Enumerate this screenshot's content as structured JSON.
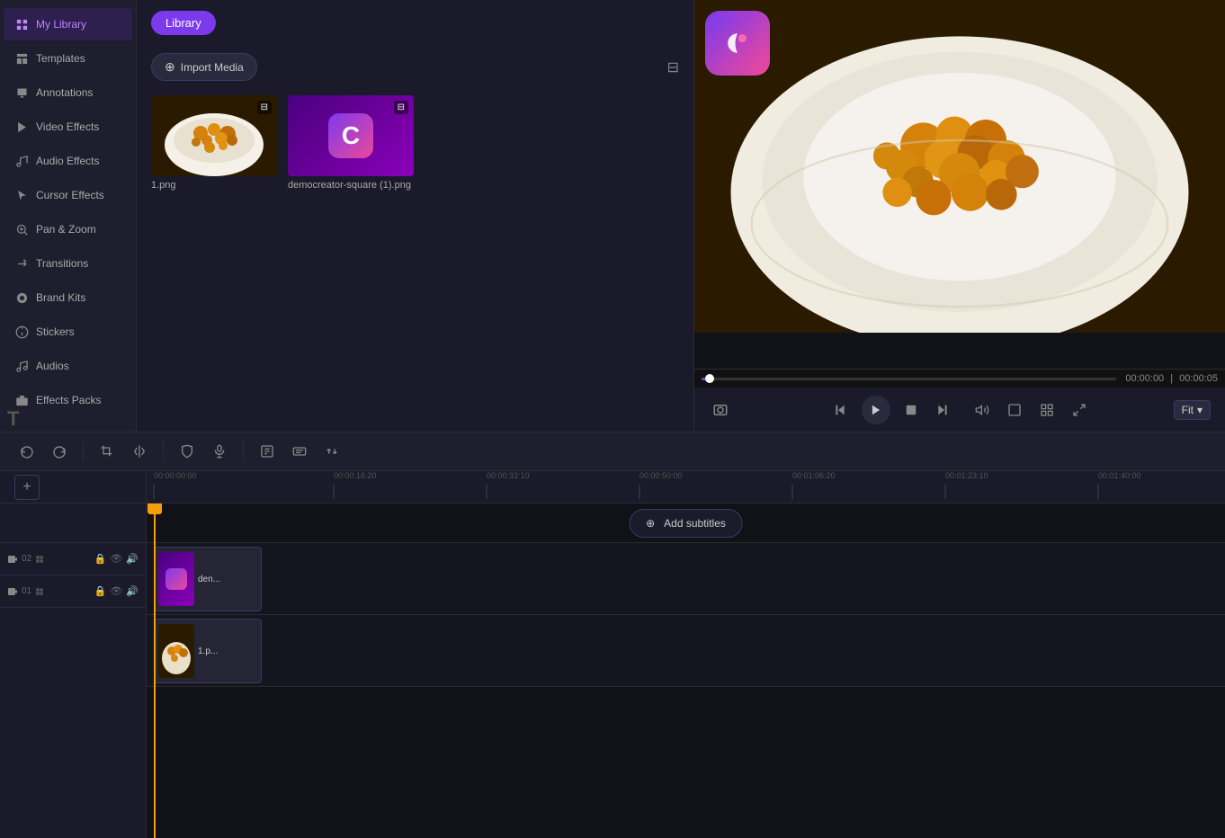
{
  "sidebar": {
    "items": [
      {
        "id": "my-library",
        "label": "My Library",
        "icon": "📁",
        "active": true
      },
      {
        "id": "templates",
        "label": "Templates",
        "icon": "🎨"
      },
      {
        "id": "annotations",
        "label": "Annotations",
        "icon": "💬"
      },
      {
        "id": "video-effects",
        "label": "Video Effects",
        "icon": "🎬"
      },
      {
        "id": "audio-effects",
        "label": "Audio Effects",
        "icon": "🎵"
      },
      {
        "id": "cursor-effects",
        "label": "Cursor Effects",
        "icon": "🖱️"
      },
      {
        "id": "pan-zoom",
        "label": "Pan & Zoom",
        "icon": "🔍"
      },
      {
        "id": "transitions",
        "label": "Transitions",
        "icon": "✨"
      },
      {
        "id": "brand-kits",
        "label": "Brand Kits",
        "icon": "🏷️"
      },
      {
        "id": "stickers",
        "label": "Stickers",
        "icon": "⭐"
      },
      {
        "id": "audios",
        "label": "Audios",
        "icon": "🎼"
      },
      {
        "id": "effects-packs",
        "label": "Effects Packs",
        "icon": "📦"
      }
    ]
  },
  "library": {
    "tab_label": "Library",
    "import_label": "Import Media",
    "media_items": [
      {
        "id": "item1",
        "name": "1.png",
        "type": "image"
      },
      {
        "id": "item2",
        "name": "democreator-square (1).png",
        "type": "image"
      }
    ]
  },
  "preview": {
    "time_current": "00:00:00",
    "time_separator": "|",
    "time_total": "00:00:05",
    "fit_label": "Fit",
    "controls": {
      "rewind": "⏮",
      "play": "▶",
      "stop": "⏹",
      "fast_forward": "⏭",
      "volume": "🔊",
      "crop": "⬛",
      "grid": "⊞",
      "expand": "⛶"
    }
  },
  "toolbar": {
    "buttons": [
      {
        "id": "undo",
        "icon": "↩"
      },
      {
        "id": "redo",
        "icon": "↪"
      },
      {
        "id": "crop",
        "icon": "⊡"
      },
      {
        "id": "split",
        "icon": "⋮"
      },
      {
        "id": "shield",
        "icon": "⛨"
      },
      {
        "id": "mic",
        "icon": "🎤"
      },
      {
        "id": "text-box",
        "icon": "▬"
      },
      {
        "id": "caption",
        "icon": "⊟"
      },
      {
        "id": "arrows",
        "icon": "⇄"
      }
    ]
  },
  "timeline": {
    "ruler_marks": [
      {
        "time": "00:00:00:00",
        "pos": 0
      },
      {
        "time": "00:00:16:20",
        "pos": 200
      },
      {
        "time": "00:00:33:10",
        "pos": 370
      },
      {
        "time": "00:00:50:00",
        "pos": 540
      },
      {
        "time": "00:01:06:20",
        "pos": 715
      },
      {
        "time": "00:01:23:10",
        "pos": 885
      },
      {
        "time": "00:01:40:00",
        "pos": 1055
      }
    ],
    "add_subtitles_label": "⊕ Add subtitles",
    "tracks": [
      {
        "id": "text-track",
        "type": "text",
        "label": "T"
      },
      {
        "id": "video-track-2",
        "type": "video",
        "num": "02",
        "clip_name": "den..."
      },
      {
        "id": "video-track-1",
        "type": "video",
        "num": "01",
        "clip_name": "1.p..."
      }
    ]
  }
}
